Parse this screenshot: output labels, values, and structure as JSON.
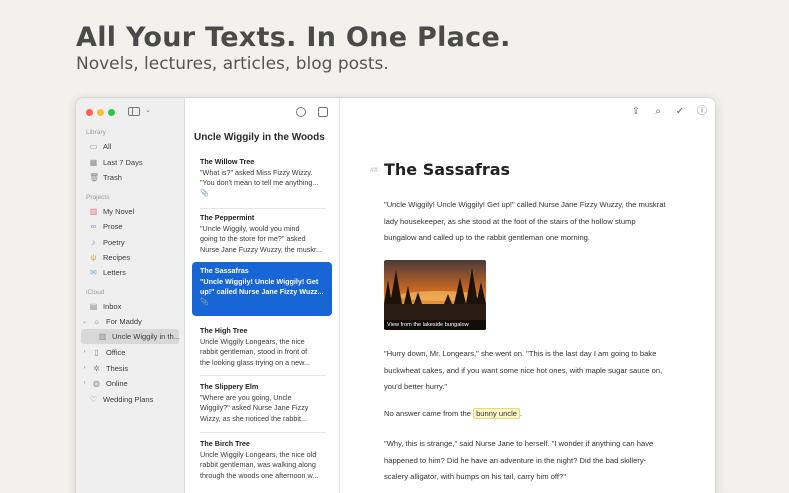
{
  "hero": {
    "title": "All Your Texts. In One Place.",
    "subtitle": "Novels, lectures, articles, blog posts."
  },
  "sidebar": {
    "library_label": "Library",
    "library": [
      {
        "label": "All",
        "icon": "tray-icon"
      },
      {
        "label": "Last 7 Days",
        "icon": "calendar-icon"
      },
      {
        "label": "Trash",
        "icon": "trash-icon"
      }
    ],
    "projects_label": "Projects",
    "projects": [
      {
        "label": "My Novel",
        "icon": "book-icon"
      },
      {
        "label": "Prose",
        "icon": "glasses-icon"
      },
      {
        "label": "Poetry",
        "icon": "mic-icon"
      },
      {
        "label": "Recipes",
        "icon": "fork-knife-icon"
      },
      {
        "label": "Letters",
        "icon": "envelope-icon"
      }
    ],
    "icloud_label": "iCloud",
    "icloud": [
      {
        "label": "Inbox",
        "icon": "inbox-icon"
      },
      {
        "label": "For Maddy",
        "icon": "sun-icon"
      },
      {
        "label": "Uncle Wiggily in th...",
        "icon": "book-icon"
      },
      {
        "label": "Office",
        "icon": "folder-icon"
      },
      {
        "label": "Thesis",
        "icon": "gear-icon"
      },
      {
        "label": "Online",
        "icon": "globe-icon"
      },
      {
        "label": "Wedding Plans",
        "icon": "heart-icon"
      }
    ]
  },
  "list": {
    "title": "Uncle Wiggily in the Woods",
    "cards": [
      {
        "title": "The Willow Tree",
        "text": "\"What is?\" asked Miss Fizzy Wizzy.\n\"You don't mean to tell me anything...",
        "attachment": "📎"
      },
      {
        "title": "The Peppermint",
        "text": "\"Uncle Wiggily, would you mind\ngoing to the store for me?\" asked\nNurse Jane Fuzzy Wuzzy, the muskr..."
      },
      {
        "title": "The Sassafras",
        "text": "\"Uncle Wiggily! Uncle Wiggily! Get\nup!\" called Nurse Jane Fizzy Wuzz...",
        "attachment": "📎"
      },
      {
        "title": "The High Tree",
        "text": "Uncle Wiggily Longears, the nice\nrabbit gentleman, stood in front of\nthe looking glass trying on a new..."
      },
      {
        "title": "The Slippery Elm",
        "text": "\"Where are you going, Uncle\nWiggily?\" asked Nurse Jane Fizzy\nWizzy, as she noticed the rabbit..."
      },
      {
        "title": "The Birch Tree",
        "text": "Uncle Wiggily Longears, the nice old\nrabbit gentleman, was walking along\nthrough the woods one afternoon w..."
      }
    ]
  },
  "editor": {
    "heading_marker": "##",
    "heading": "The Sassafras",
    "p1": "\"Uncle Wiggily! Uncle Wiggily! Get up!\" called Nurse Jane Fizzy Wuzzy, the muskrat lady housekeeper, as she stood at the foot of the stairs of the hollow stump bungalow and called up to the rabbit gentleman one morning.",
    "image_caption": "View from the lakeside bungalow",
    "p2": "\"Hurry down, Mr. Longears,\" she went on. \"This is the last day I am going to bake buckwheat cakes, and if you want some nice hot ones, with maple sugar sauce on, you'd better hurry.\"",
    "p3_before": "No answer came from the ",
    "p3_highlight": "bunny uncle",
    "p3_after": ".",
    "p4": "\"Why, this is strange,\" said Nurse Jane to herself. \"I wonder if anything can have happened to him? Did he have an adventure in the night? Did the bad skillery-scalery alligator, with humps on his tail, carry him off?\""
  },
  "colors": {
    "accent": "#1866d6",
    "highlight": "#fdf6c7"
  }
}
